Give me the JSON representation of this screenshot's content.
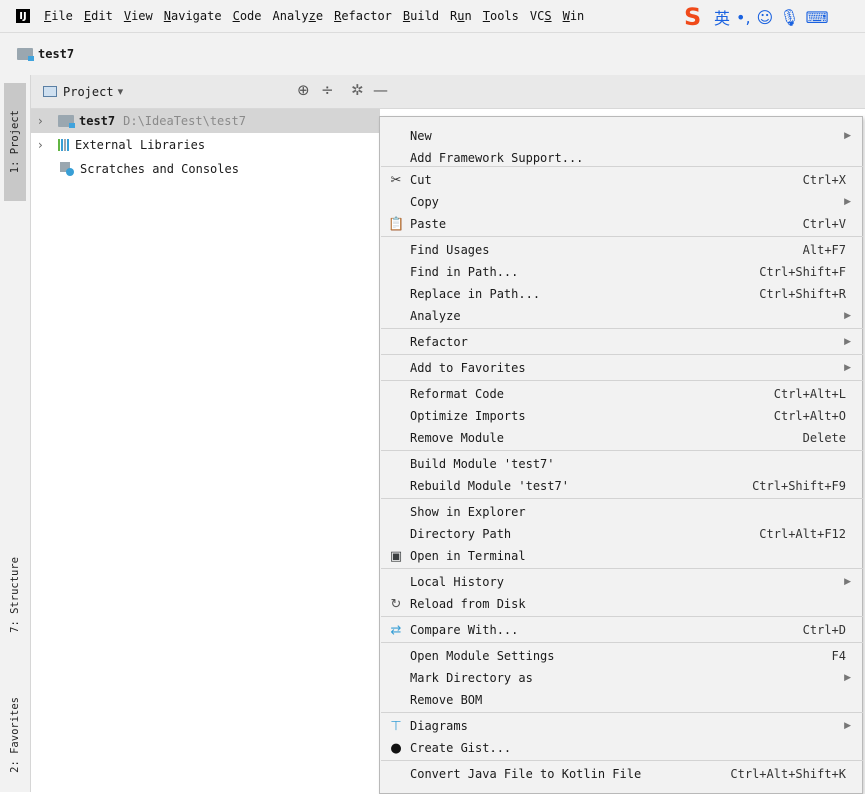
{
  "menubar": {
    "items": [
      {
        "before": "",
        "u": "F",
        "after": "ile"
      },
      {
        "before": "",
        "u": "E",
        "after": "dit"
      },
      {
        "before": "",
        "u": "V",
        "after": "iew"
      },
      {
        "before": "",
        "u": "N",
        "after": "avigate"
      },
      {
        "before": "",
        "u": "C",
        "after": "ode"
      },
      {
        "before": "Analy",
        "u": "z",
        "after": "e"
      },
      {
        "before": "",
        "u": "R",
        "after": "efactor"
      },
      {
        "before": "",
        "u": "B",
        "after": "uild"
      },
      {
        "before": "R",
        "u": "u",
        "after": "n"
      },
      {
        "before": "",
        "u": "T",
        "after": "ools"
      },
      {
        "before": "VC",
        "u": "S",
        "after": ""
      },
      {
        "before": "",
        "u": "W",
        "after": "in"
      }
    ],
    "ime": {
      "logo": "S",
      "lang": "英",
      "punct": "•,",
      "face": "☺",
      "mic": "🎙",
      "kbd": "⌨"
    }
  },
  "breadcrumb": {
    "label": "test7"
  },
  "stripe": {
    "project": "1: Project",
    "structure": "7: Structure",
    "favorites": "2: Favorites"
  },
  "panel": {
    "title": "Project",
    "icons": {
      "locate": "⊕",
      "collapse": "÷",
      "settings": "✲",
      "hide": "—"
    },
    "tree": [
      {
        "name": "test7",
        "path": "D:\\IdeaTest\\test7"
      },
      {
        "name": "External Libraries"
      },
      {
        "name": "Scratches and Consoles"
      }
    ]
  },
  "context_menu": {
    "items": [
      {
        "label": "New",
        "submenu": true
      },
      {
        "label": "Add Framework Support..."
      },
      {
        "label": "Cut",
        "shortcut": "Ctrl+X",
        "icon": "scissors-icon"
      },
      {
        "label": "Copy",
        "submenu": true
      },
      {
        "label": "Paste",
        "shortcut": "Ctrl+V",
        "icon": "clipboard-icon"
      },
      {
        "label": "Find Usages",
        "shortcut": "Alt+F7"
      },
      {
        "label": "Find in Path...",
        "shortcut": "Ctrl+Shift+F"
      },
      {
        "label": "Replace in Path...",
        "shortcut": "Ctrl+Shift+R"
      },
      {
        "label": "Analyze",
        "submenu": true
      },
      {
        "label": "Refactor",
        "submenu": true
      },
      {
        "label": "Add to Favorites",
        "submenu": true
      },
      {
        "label": "Reformat Code",
        "shortcut": "Ctrl+Alt+L"
      },
      {
        "label": "Optimize Imports",
        "shortcut": "Ctrl+Alt+O"
      },
      {
        "label": "Remove Module",
        "shortcut": "Delete"
      },
      {
        "label": "Build Module 'test7'"
      },
      {
        "label": "Rebuild Module 'test7'",
        "shortcut": "Ctrl+Shift+F9"
      },
      {
        "label": "Show in Explorer"
      },
      {
        "label": "Directory Path",
        "shortcut": "Ctrl+Alt+F12"
      },
      {
        "label": "Open in Terminal",
        "icon": "terminal-icon"
      },
      {
        "label": "Local History",
        "submenu": true
      },
      {
        "label": "Reload from Disk",
        "icon": "reload-icon"
      },
      {
        "label": "Compare With...",
        "shortcut": "Ctrl+D",
        "icon": "compare-icon"
      },
      {
        "label": "Open Module Settings",
        "shortcut": "F4"
      },
      {
        "label": "Mark Directory as",
        "submenu": true
      },
      {
        "label": "Remove BOM"
      },
      {
        "label": "Diagrams",
        "submenu": true,
        "icon": "diagram-icon"
      },
      {
        "label": "Create Gist...",
        "icon": "github-icon"
      },
      {
        "label": "Convert Java File to Kotlin File",
        "shortcut": "Ctrl+Alt+Shift+K"
      }
    ]
  }
}
